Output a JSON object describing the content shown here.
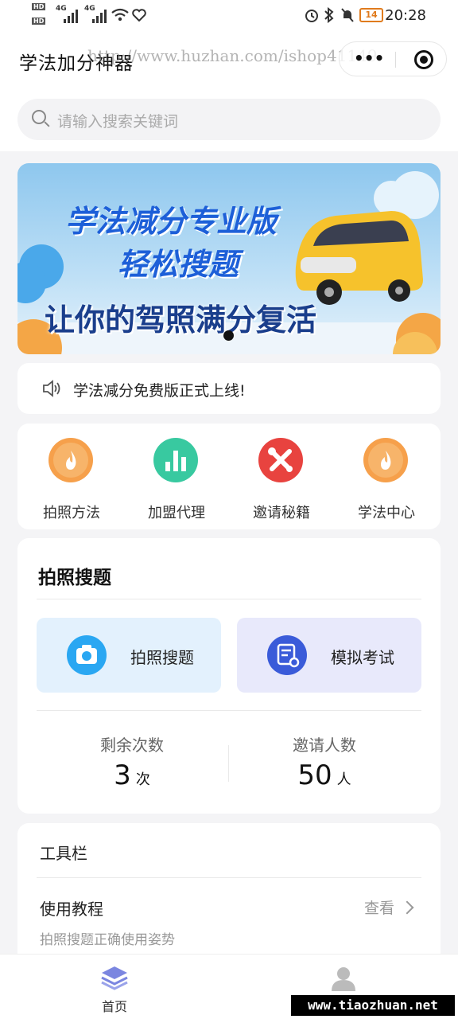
{
  "status_bar": {
    "left_indicators": [
      "HD",
      "HD",
      "4G",
      "4G"
    ],
    "battery": "14",
    "time": "20:28"
  },
  "header": {
    "title": "学法加分神器",
    "watermark": "http://www.huzhan.com/ishop41149",
    "capsule_dots": "•••"
  },
  "search": {
    "placeholder": "请输入搜索关键词"
  },
  "banner": {
    "line1": "学法减分专业版",
    "line2": "轻松搜题",
    "line3": "让你的驾照满分复活"
  },
  "notice": {
    "text": "学法减分免费版正式上线!"
  },
  "quick_actions": [
    {
      "label": "拍照方法",
      "icon": "fire-icon",
      "color": "#f6a04b"
    },
    {
      "label": "加盟代理",
      "icon": "bar-chart-icon",
      "color": "#38c9a0"
    },
    {
      "label": "邀请秘籍",
      "icon": "tools-icon",
      "color": "#e8433f"
    },
    {
      "label": "学法中心",
      "icon": "fire-icon",
      "color": "#f6a04b"
    }
  ],
  "photo_search": {
    "title": "拍照搜题",
    "tiles": [
      {
        "label": "拍照搜题",
        "icon": "camera-icon",
        "bg": "#e3f1fd",
        "icon_color": "#2aa7f2"
      },
      {
        "label": "模拟考试",
        "icon": "exam-icon",
        "bg": "#e8e9fb",
        "icon_color": "#3a5bd9"
      }
    ],
    "stats": [
      {
        "label": "剩余次数",
        "value": "3",
        "unit": "次"
      },
      {
        "label": "邀请人数",
        "value": "50",
        "unit": "人"
      }
    ]
  },
  "tools": {
    "title": "工具栏",
    "items": [
      {
        "label": "使用教程",
        "subtitle": "拍照搜题正确使用姿势",
        "action": "查看"
      }
    ]
  },
  "tab_bar": {
    "home_label": "首页",
    "mine_label": ""
  },
  "footer_watermark": "www.tiaozhuan.net"
}
